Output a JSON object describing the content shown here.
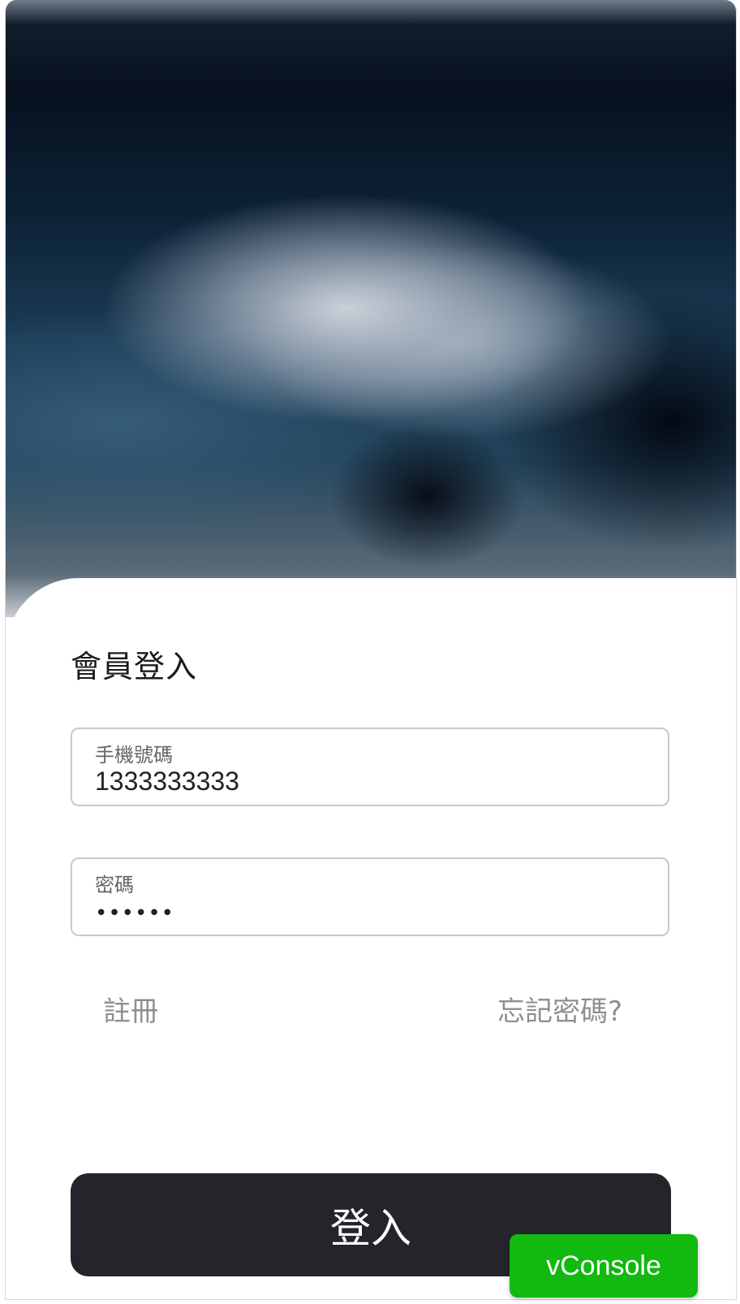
{
  "login": {
    "title": "會員登入",
    "phone": {
      "label": "手機號碼",
      "value": "1333333333"
    },
    "password": {
      "label": "密碼",
      "masked_value": "••••••"
    },
    "register_label": "註冊",
    "forgot_label": "忘記密碼?",
    "submit_label": "登入"
  },
  "debug": {
    "vconsole_label": "vConsole"
  },
  "colors": {
    "button_bg": "#23252b",
    "vconsole_bg": "#12b90f",
    "link_text": "#8f8f8f"
  }
}
